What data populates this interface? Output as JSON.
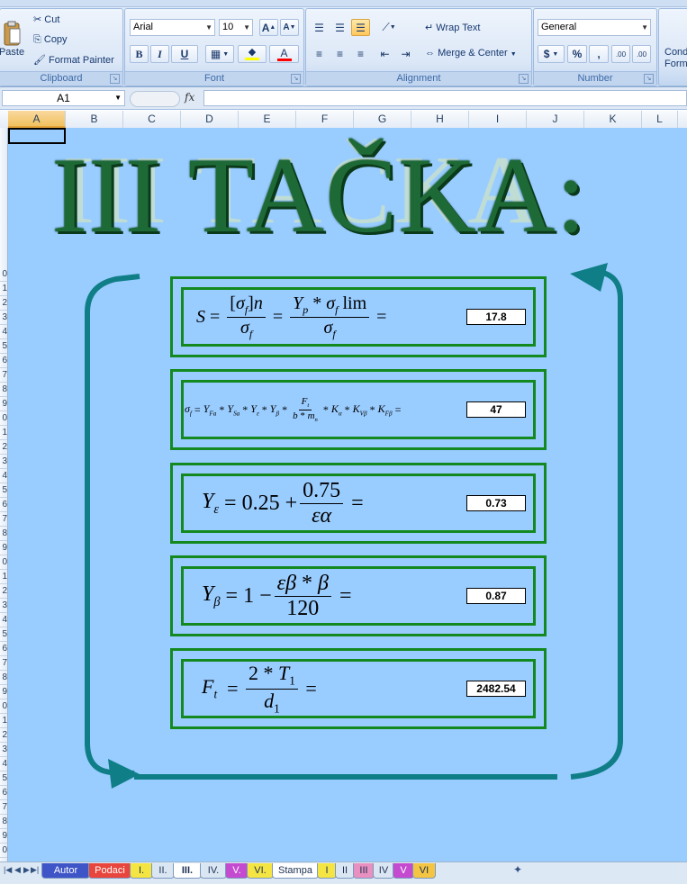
{
  "ribbon": {
    "clipboard": {
      "label": "Clipboard",
      "paste": "Paste",
      "cut": "Cut",
      "copy": "Copy",
      "format_painter": "Format Painter"
    },
    "font": {
      "label": "Font",
      "name": "Arial",
      "size": "10",
      "grow": "A",
      "shrink": "A",
      "bold": "B",
      "italic": "I",
      "underline": "U",
      "font_color_letter": "A"
    },
    "alignment": {
      "label": "Alignment",
      "wrap_text": "Wrap Text",
      "merge_center": "Merge & Center"
    },
    "number": {
      "label": "Number",
      "format": "General",
      "currency": "$",
      "percent": "%",
      "comma": ",",
      "inc_decimal": ".00",
      "dec_decimal": ".00"
    },
    "cond_format": "Cond Form"
  },
  "formula_bar": {
    "name_box": "A1",
    "fx": "fx",
    "value": ""
  },
  "columns": [
    "A",
    "B",
    "C",
    "D",
    "E",
    "F",
    "G",
    "H",
    "I",
    "J",
    "K",
    "L"
  ],
  "rows": [
    "0",
    "1",
    "2",
    "3",
    "4",
    "5",
    "6",
    "7",
    "8",
    "9",
    "0",
    "1",
    "2",
    "3",
    "4",
    "5",
    "6",
    "7",
    "8",
    "9",
    "0",
    "1",
    "2",
    "3",
    "4",
    "5",
    "6",
    "7",
    "8",
    "9",
    "0",
    "1",
    "2",
    "3",
    "4",
    "5",
    "6",
    "7",
    "8",
    "9",
    "0",
    "1",
    "2",
    "3",
    "4",
    "5",
    "6",
    "7",
    "8",
    "9",
    "0"
  ],
  "sheet": {
    "title": "III TAČKA:",
    "watermark": "III TAČKA",
    "panels": [
      {
        "value": "17.8"
      },
      {
        "value": "47"
      },
      {
        "value": "0.73"
      },
      {
        "value": "0.87"
      },
      {
        "value": "2482.54"
      }
    ]
  },
  "tabs": [
    {
      "label": "Autor",
      "color": "#3e55c8"
    },
    {
      "label": "Podaci",
      "color": "#e8453c"
    },
    {
      "label": "I.",
      "color": "#f4e542"
    },
    {
      "label": "II.",
      "color": "#dbe6f3"
    },
    {
      "label": "III.",
      "color": "#ffffff"
    },
    {
      "label": "IV.",
      "color": "#dbe6f3"
    },
    {
      "label": "V.",
      "color": "#c44ad0"
    },
    {
      "label": "VI.",
      "color": "#f4e542"
    },
    {
      "label": "Stampa",
      "color": "#ffffff"
    },
    {
      "label": "I",
      "color": "#f4e542"
    },
    {
      "label": "II",
      "color": "#dbe6f3"
    },
    {
      "label": "III",
      "color": "#e890c0"
    },
    {
      "label": "IV",
      "color": "#dbe6f3"
    },
    {
      "label": "V",
      "color": "#c44ad0"
    },
    {
      "label": "VI",
      "color": "#f4c542"
    }
  ],
  "colors": {
    "sheet_bg": "#99ccff",
    "panel_border": "#13891f",
    "arrow": "#0f7e86",
    "title": "#1e6a37"
  }
}
